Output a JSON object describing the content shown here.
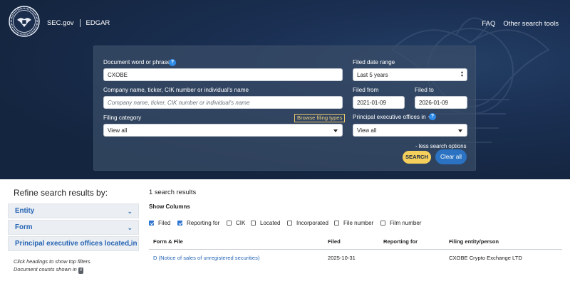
{
  "header": {
    "sec_link": "SEC.gov",
    "edgar_link": "EDGAR",
    "faq_link": "FAQ",
    "other_link": "Other search tools"
  },
  "search": {
    "doc_label": "Document word or phrase",
    "doc_value": "CXOBE",
    "company_label": "Company name, ticker, CIK number or individual's name",
    "company_placeholder": "Company name, ticker, CIK number or individual's name",
    "category_label": "Filing category",
    "category_value": "View all",
    "browse_label": "Browse filing types",
    "date_range_label": "Filed date range",
    "date_range_value": "Last 5 years",
    "from_label": "Filed from",
    "from_value": "2021-01-09",
    "to_label": "Filed to",
    "to_value": "2026-01-09",
    "offices_label": "Principal executive offices in",
    "offices_value": "View all",
    "less_options": "- less search options",
    "search_button": "SEARCH",
    "clear_button": "Clear all"
  },
  "refine": {
    "title": "Refine search results by:",
    "facets": [
      "Entity",
      "Form",
      "Principal executive offices located in"
    ],
    "hint_line1": "Click headings to show top filters.",
    "hint_line2": "Document counts shown in",
    "hint_badge": "#"
  },
  "results": {
    "count": "1 search results",
    "show_columns_label": "Show Columns",
    "columns": [
      {
        "label": "Filed",
        "checked": true
      },
      {
        "label": "Reporting for",
        "checked": true
      },
      {
        "label": "CIK",
        "checked": false
      },
      {
        "label": "Located",
        "checked": false
      },
      {
        "label": "Incorporated",
        "checked": false
      },
      {
        "label": "File number",
        "checked": false
      },
      {
        "label": "Film number",
        "checked": false
      }
    ],
    "headers": [
      "Form & File",
      "Filed",
      "Reporting for",
      "Filing entity/person"
    ],
    "rows": [
      {
        "form": "D (Notice of sales of unregistered securities)",
        "filed": "2025-10-31",
        "reporting_for": "",
        "entity": "CXOBE Crypto Exchange LTD"
      }
    ]
  },
  "colors": {
    "header_bg": "#1a2f52",
    "panel_bg": "#3a4d68",
    "search_button": "#f4cf5b",
    "clear_button": "#2b73c2",
    "link": "#2564b5"
  }
}
